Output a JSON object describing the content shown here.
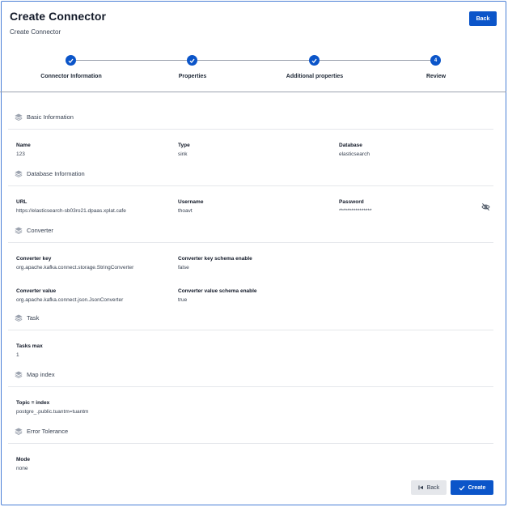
{
  "header": {
    "title": "Create Connector",
    "subtitle": "Create Connector",
    "back_label": "Back"
  },
  "stepper": {
    "steps": [
      {
        "label": "Connector Information",
        "state": "completed"
      },
      {
        "label": "Properties",
        "state": "completed"
      },
      {
        "label": "Additional properties",
        "state": "completed"
      },
      {
        "label": "Review",
        "state": "current",
        "number": "4"
      }
    ]
  },
  "sections": {
    "basic": {
      "title": "Basic Information",
      "fields": [
        {
          "label": "Name",
          "value": "123"
        },
        {
          "label": "Type",
          "value": "sink"
        },
        {
          "label": "Database",
          "value": "elasticsearch"
        }
      ]
    },
    "database": {
      "title": "Database Information",
      "fields": [
        {
          "label": "URL",
          "value": "https://elasticsearch-sb03ro21.dpaas.xplat.cafe"
        },
        {
          "label": "Username",
          "value": "thoavt"
        },
        {
          "label": "Password",
          "value": "****************"
        }
      ]
    },
    "converter": {
      "title": "Converter",
      "fields": [
        {
          "label": "Converter key",
          "value": "org.apache.kafka.connect.storage.StringConverter"
        },
        {
          "label": "Converter key schema enable",
          "value": "false"
        },
        {
          "label": "Converter value",
          "value": "org.apache.kafka.connect.json.JsonConverter"
        },
        {
          "label": "Converter value schema enable",
          "value": "true"
        }
      ]
    },
    "task": {
      "title": "Task",
      "fields": [
        {
          "label": "Tasks max",
          "value": "1"
        }
      ]
    },
    "map_index": {
      "title": "Map index",
      "fields": [
        {
          "label": "Topic = index",
          "value": "postgre_.public.tuantm=tuantm"
        }
      ]
    },
    "error": {
      "title": "Error Tolerance",
      "fields": [
        {
          "label": "Mode",
          "value": "none"
        }
      ]
    }
  },
  "footer": {
    "back_label": "Back",
    "create_label": "Create"
  },
  "colors": {
    "primary": "#0b55c9",
    "divider": "#e5e7eb",
    "secondary_button": "#e5e7eb"
  },
  "icons": {
    "step_complete": "check-icon",
    "section": "layers-icon",
    "password_toggle": "eye-off-icon",
    "back": "skip-back-icon",
    "create": "check-icon"
  }
}
